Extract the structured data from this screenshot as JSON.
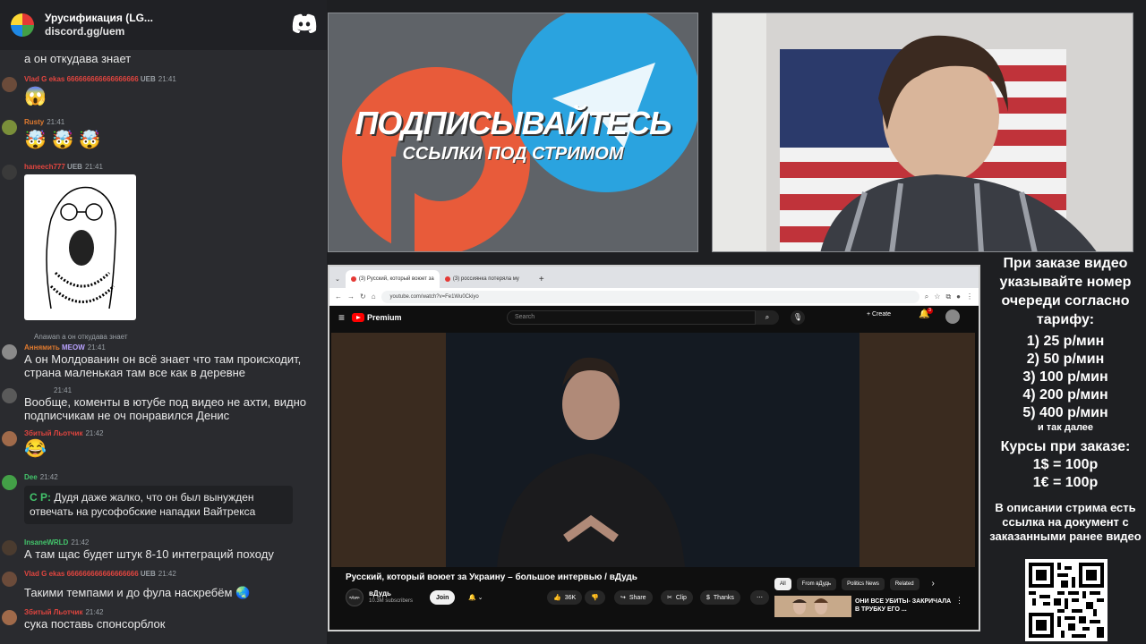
{
  "discord": {
    "server_name": "Урусификация (LG...",
    "invite": "discord.gg/uem",
    "messages": [
      {
        "text": "а он откудава знает"
      },
      {
        "user": "Vlad G     ekas 666666666666666666",
        "badges": "UEB",
        "time": "21:41",
        "emoji": "😱"
      },
      {
        "user": "Rusty",
        "time": "21:41",
        "emoji": "🤯 🤯 🤯"
      },
      {
        "user": "haneech777",
        "badges": "UEB",
        "time": "21:41"
      },
      {
        "reply": "Anawan а он откудава знает",
        "user": "Аннямить",
        "badges": "MEOW",
        "time": "21:41",
        "text": "А он Молдованин он всё знает что там происходит, страна маленькая там все как в деревне"
      },
      {
        "time": "21:41",
        "text": "Вообще, коменты в ютубе под видео не ахти, видно подписчикам не оч понравился Денис"
      },
      {
        "user": "Збитый Льотчик",
        "time": "21:42",
        "emoji": "😂"
      },
      {
        "user": "Dee",
        "time": "21:42",
        "quote_user": "C        P:",
        "quote_text": "Дудя даже жалко, что он был вынужден отвечать на русофобские нападки Вайтрекса"
      },
      {
        "user": "InsaneWRLD",
        "time": "21:42",
        "text": "А там щас будет штук 8-10 интеграций походу"
      },
      {
        "user": "Vlad G     ekas 666666666666666666",
        "badges": "UEB",
        "time": "21:42",
        "text": "Такими темпами и до фула наскребём 🌏"
      },
      {
        "user": "Збитый Льотчик",
        "time": "21:42",
        "text": "сука поставь спонсорблок"
      }
    ]
  },
  "promo": {
    "title": "ПОДПИСЫВАЙТЕСЬ",
    "subtitle": "ССЫЛКИ ПОД СТРИМОМ"
  },
  "browser": {
    "tabs": [
      "(3) Русский, который воюет за",
      "(3) россиянка потеряла му"
    ],
    "url": "youtube.com/watch?v=Fe1Wu0Ckiyo",
    "yt_brand": "Premium",
    "search_placeholder": "Search",
    "create_label": "Create",
    "notif_count": "3",
    "video_title": "Русский, который воюет за Украину – большое интервью / вДудь",
    "channel_name": "вДудь",
    "channel_logo": "вДудь",
    "subscribers": "10.3M subscribers",
    "join": "Join",
    "likes": "36K",
    "share": "Share",
    "clip": "Clip",
    "thanks": "Thanks",
    "chips": [
      "All",
      "From вДудь",
      "Politics News",
      "Related"
    ],
    "related_title": "ОНИ ВСЕ УБИТЫ- ЗАКРИЧАЛА В ТРУБКУ ЕГО ..."
  },
  "info": {
    "order_text": "При заказе видео указывайте номер очереди согласно тарифу:",
    "prices": [
      "1) 25 р/мин",
      "2) 50 р/мин",
      "3) 100 р/мин",
      "4) 200 р/мин",
      "5) 400 р/мин"
    ],
    "etc": "и так далее",
    "courses_title": "Курсы при заказе:",
    "courses": [
      "1$ = 100р",
      "1€ = 100р"
    ],
    "desc": "В описании стрима есть ссылка на документ с заказанными ранее видео"
  },
  "colors": {
    "chat_bg": "#2a2b2f",
    "username_red": "#e0453f",
    "username_orange": "#e07a2f",
    "username_green": "#43c46b",
    "youtube_red": "#ff0000",
    "telegram_blue": "#2aa3df",
    "patreon_orange": "#e85b3a"
  }
}
